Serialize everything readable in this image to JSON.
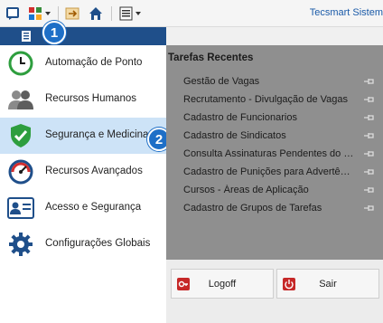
{
  "toolbar": {
    "brand": "Tecsmart Sistem"
  },
  "menu": {
    "items": [
      {
        "label": "Automação de Ponto",
        "icon": "clock-icon"
      },
      {
        "label": "Recursos Humanos",
        "icon": "people-icon"
      },
      {
        "label": "Segurança e Medicina",
        "icon": "shield-check-icon",
        "selected": true
      },
      {
        "label": "Recursos Avançados",
        "icon": "gauge-icon"
      },
      {
        "label": "Acesso e Segurança",
        "icon": "id-card-icon"
      },
      {
        "label": "Configurações Globais",
        "icon": "gear-icon"
      }
    ]
  },
  "badges": {
    "one": "1",
    "two": "2"
  },
  "recent": {
    "title": "Tarefas Recentes",
    "items": [
      "Gestão de Vagas",
      "Recrutamento - Divulgação de Vagas",
      "Cadastro de Funcionarios",
      "Cadastro de Sindicatos",
      "Consulta Assinaturas Pendentes do Es...",
      "Cadastro de Punições para Advertênci...",
      "Cursos - Áreas de Aplicação",
      "Cadastro de Grupos de Tarefas"
    ]
  },
  "buttons": {
    "logoff": "Logoff",
    "exit": "Sair"
  },
  "colors": {
    "header": "#1f4f8a",
    "selected": "#cde3f7",
    "panel": "#8f8f8f",
    "badge": "#1e6fc7",
    "accent_green": "#2e9e3e",
    "danger": "#c62828"
  }
}
